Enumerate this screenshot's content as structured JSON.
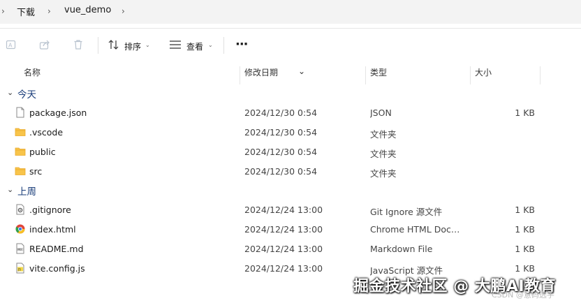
{
  "breadcrumb": {
    "items": [
      "下载",
      "vue_demo"
    ]
  },
  "toolbar": {
    "sort_label": "排序",
    "view_label": "查看",
    "more_label": "···"
  },
  "columns": {
    "name": "名称",
    "modified": "修改日期",
    "type": "类型",
    "size": "大小"
  },
  "groups": [
    {
      "label": "今天",
      "rows": [
        {
          "icon": "file-icon",
          "name": "package.json",
          "modified": "2024/12/30 0:54",
          "type": "JSON",
          "size": "1 KB"
        },
        {
          "icon": "folder-icon",
          "name": ".vscode",
          "modified": "2024/12/30 0:54",
          "type": "文件夹",
          "size": ""
        },
        {
          "icon": "folder-icon",
          "name": "public",
          "modified": "2024/12/30 0:54",
          "type": "文件夹",
          "size": ""
        },
        {
          "icon": "folder-icon",
          "name": "src",
          "modified": "2024/12/30 0:54",
          "type": "文件夹",
          "size": ""
        }
      ]
    },
    {
      "label": "上周",
      "rows": [
        {
          "icon": "settings-file-icon",
          "name": ".gitignore",
          "modified": "2024/12/24 13:00",
          "type": "Git Ignore 源文件",
          "size": "1 KB"
        },
        {
          "icon": "chrome-file-icon",
          "name": "index.html",
          "modified": "2024/12/24 13:00",
          "type": "Chrome HTML Document",
          "size": "1 KB"
        },
        {
          "icon": "md-file-icon",
          "name": "README.md",
          "modified": "2024/12/24 13:00",
          "type": "Markdown File",
          "size": "1 KB"
        },
        {
          "icon": "js-file-icon",
          "name": "vite.config.js",
          "modified": "2024/12/24 13:00",
          "type": "JavaScript 源文件",
          "size": "1 KB"
        }
      ]
    }
  ],
  "watermark": {
    "text": "掘金技术社区 @ 大鹏AI教育",
    "csdn": "CSDN @意码选手"
  },
  "colors": {
    "folder": "#f8c44a",
    "folder_dark": "#e9a92a",
    "group_label": "#1a3d7a"
  }
}
